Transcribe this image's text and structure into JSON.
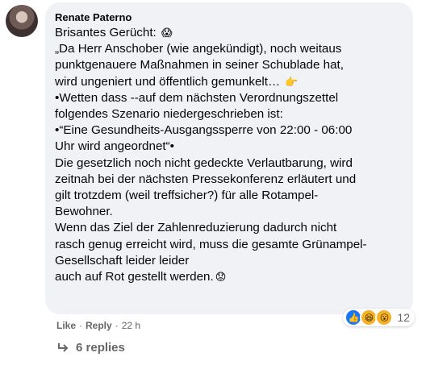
{
  "comment": {
    "author": "Renate Paterno",
    "lines": [
      "Brisantes Gerücht:",
      "„Da Herr Anschober (wie angekündigt), noch weitaus",
      "punktgenauere Maßnahmen in seiner Schublade hat,",
      "wird ungeniert und öffentlich gemunkelt…",
      "•Wetten dass --auf dem nächsten Verordnungszettel",
      "folgendes Szenario niedergeschrieben ist:",
      "•“Eine Gesundheits-Ausgangssperre von 22:00 - 06:00",
      "Uhr wird angeordnet“•",
      "Die gesetzlich noch nicht gedeckte Verlautbarung, wird",
      "zeitnah bei der nächsten Pressekonferenz erläutert und",
      "gilt trotzdem (weil treffsicher?) für alle Rotampel-",
      "Bewohner.",
      "Wenn das Ziel der Zahlenreduzierung dadurch nicht",
      "rasch genug erreicht wird, muss die gesamte Grünampel-",
      "Gesellschaft leider leider",
      "auch auf Rot gestellt werden."
    ],
    "emoji": {
      "scream": "😱",
      "point_right": "👉",
      "worried": "😟"
    }
  },
  "reactions": {
    "like_glyph": "👍",
    "haha_glyph": "😆",
    "wow_glyph": "😮",
    "count": "12"
  },
  "actions": {
    "like": "Like",
    "reply": "Reply",
    "separator": "·",
    "time": "22 h"
  },
  "replies": {
    "label": "6 replies"
  },
  "colors": {
    "bubble": "#f0f2f5",
    "text": "#050505",
    "muted": "#65676b",
    "like_blue": "#1877f2"
  }
}
